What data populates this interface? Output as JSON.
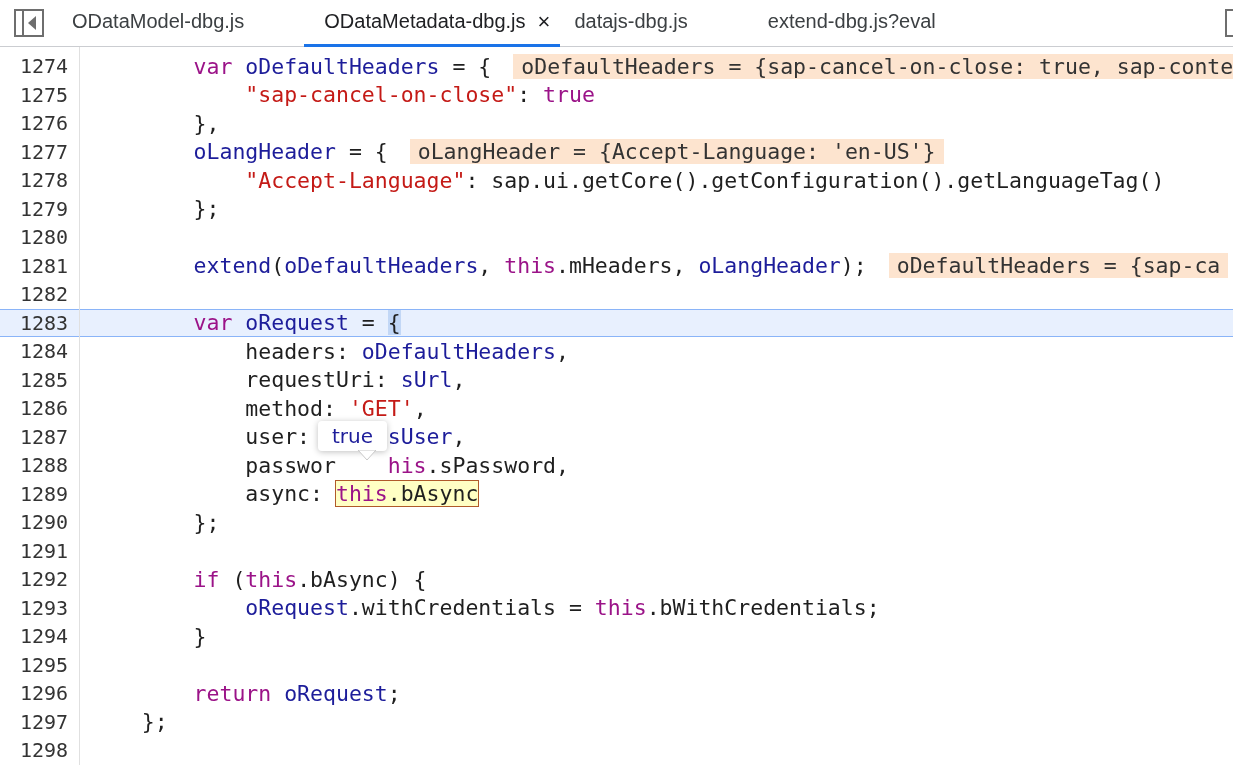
{
  "tabs": [
    {
      "label": "ODataModel-dbg.js",
      "selected": false
    },
    {
      "label": "ODataMetadata-dbg.js",
      "selected": true,
      "close": "×"
    },
    {
      "label": "datajs-dbg.js",
      "selected": false
    },
    {
      "label": "extend-dbg.js?eval",
      "selected": false
    }
  ],
  "editor": {
    "lines": [
      {
        "number": "1274",
        "current": false,
        "tokens": [
          {
            "kind": "keyword",
            "text": "        var "
          },
          {
            "kind": "variable",
            "text": "oDefaultHeaders"
          },
          {
            "kind": "plain",
            "text": " = {"
          }
        ],
        "inline_value": "oDefaultHeaders = {sap-cancel-on-close: true, sap-conte"
      },
      {
        "number": "1275",
        "current": false,
        "tokens": [
          {
            "kind": "string",
            "text": "            \"sap-cancel-on-close\""
          },
          {
            "kind": "plain",
            "text": ": "
          },
          {
            "kind": "keyword",
            "text": "true"
          }
        ]
      },
      {
        "number": "1276",
        "current": false,
        "tokens": [
          {
            "kind": "plain",
            "text": "        },"
          }
        ]
      },
      {
        "number": "1277",
        "current": false,
        "tokens": [
          {
            "kind": "variable",
            "text": "        oLangHeader"
          },
          {
            "kind": "plain",
            "text": " = {"
          }
        ],
        "inline_value": "oLangHeader = {Accept-Language: 'en-US'}"
      },
      {
        "number": "1278",
        "current": false,
        "tokens": [
          {
            "kind": "string",
            "text": "            \"Accept-Language\""
          },
          {
            "kind": "plain",
            "text": ": sap.ui.getCore().getConfiguration().getLanguageTag()"
          }
        ]
      },
      {
        "number": "1279",
        "current": false,
        "tokens": [
          {
            "kind": "plain",
            "text": "        };"
          }
        ]
      },
      {
        "number": "1280",
        "current": false
      },
      {
        "number": "1281",
        "current": false,
        "tokens": [
          {
            "kind": "variable",
            "text": "        extend"
          },
          {
            "kind": "plain",
            "text": "("
          },
          {
            "kind": "variable",
            "text": "oDefaultHeaders"
          },
          {
            "kind": "plain",
            "text": ", "
          },
          {
            "kind": "keyword",
            "text": "this"
          },
          {
            "kind": "plain",
            "text": ".mHeaders, "
          },
          {
            "kind": "variable",
            "text": "oLangHeader"
          },
          {
            "kind": "plain",
            "text": ");"
          }
        ],
        "inline_value": "oDefaultHeaders = {sap-ca"
      },
      {
        "number": "1282",
        "current": false
      },
      {
        "number": "1283",
        "current": true,
        "tokens": [
          {
            "kind": "keyword",
            "text": "        var "
          },
          {
            "kind": "variable",
            "text": "oRequest"
          },
          {
            "kind": "plain",
            "text": " = "
          }
        ],
        "bracket": "{"
      },
      {
        "number": "1284",
        "current": false,
        "tokens": [
          {
            "kind": "plain",
            "text": "            headers: "
          },
          {
            "kind": "variable",
            "text": "oDefaultHeaders"
          },
          {
            "kind": "plain",
            "text": ","
          }
        ]
      },
      {
        "number": "1285",
        "current": false,
        "tokens": [
          {
            "kind": "plain",
            "text": "            requestUri: "
          },
          {
            "kind": "variable",
            "text": "sUrl"
          },
          {
            "kind": "plain",
            "text": ","
          }
        ]
      },
      {
        "number": "1286",
        "current": false,
        "tokens": [
          {
            "kind": "plain",
            "text": "            method: "
          },
          {
            "kind": "string",
            "text": "'GET'"
          },
          {
            "kind": "plain",
            "text": ","
          }
        ]
      },
      {
        "number": "1287",
        "current": false,
        "tokens": [
          {
            "kind": "plain",
            "text": "            user:      "
          },
          {
            "kind": "variable",
            "text": "sUser"
          },
          {
            "kind": "plain",
            "text": ","
          }
        ]
      },
      {
        "number": "1288",
        "current": false,
        "tokens": [
          {
            "kind": "plain",
            "text": "            passwor    "
          },
          {
            "kind": "keyword",
            "text": "his"
          },
          {
            "kind": "plain",
            "text": ".sPassword,"
          }
        ]
      },
      {
        "number": "1289",
        "current": false,
        "tokens": [
          {
            "kind": "plain",
            "text": "            async: "
          }
        ],
        "hovered": [
          {
            "kind": "keyword",
            "text": "this"
          },
          {
            "kind": "plain",
            "text": ".bAsync"
          }
        ]
      },
      {
        "number": "1290",
        "current": false,
        "tokens": [
          {
            "kind": "plain",
            "text": "        };"
          }
        ]
      },
      {
        "number": "1291",
        "current": false
      },
      {
        "number": "1292",
        "current": false,
        "tokens": [
          {
            "kind": "keyword",
            "text": "        if"
          },
          {
            "kind": "plain",
            "text": " ("
          },
          {
            "kind": "keyword",
            "text": "this"
          },
          {
            "kind": "plain",
            "text": ".bAsync) {"
          }
        ]
      },
      {
        "number": "1293",
        "current": false,
        "tokens": [
          {
            "kind": "variable",
            "text": "            oRequest"
          },
          {
            "kind": "plain",
            "text": ".withCredentials = "
          },
          {
            "kind": "keyword",
            "text": "this"
          },
          {
            "kind": "plain",
            "text": ".bWithCredentials;"
          }
        ]
      },
      {
        "number": "1294",
        "current": false,
        "tokens": [
          {
            "kind": "plain",
            "text": "        }"
          }
        ]
      },
      {
        "number": "1295",
        "current": false
      },
      {
        "number": "1296",
        "current": false,
        "tokens": [
          {
            "kind": "keyword",
            "text": "        return "
          },
          {
            "kind": "variable",
            "text": "oRequest"
          },
          {
            "kind": "plain",
            "text": ";"
          }
        ]
      },
      {
        "number": "1297",
        "current": false,
        "tokens": [
          {
            "kind": "plain",
            "text": "    };"
          }
        ]
      },
      {
        "number": "1298",
        "current": false
      }
    ],
    "tooltip": {
      "value": "true"
    }
  }
}
